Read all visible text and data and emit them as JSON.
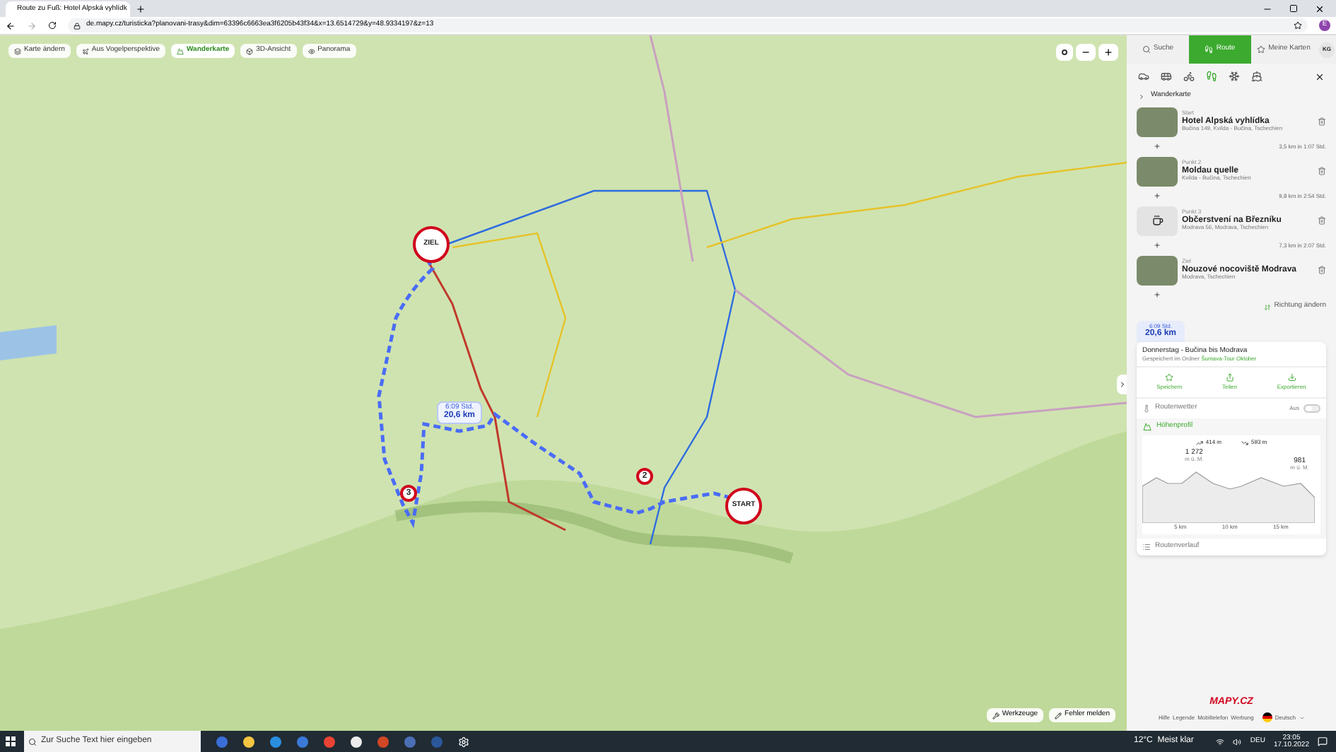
{
  "browser": {
    "tab_title": "Route zu Fuß: Hotel Alpská vyhlídk",
    "url": "de.mapy.cz/turisticka?planovani-trasy&dim=63396c6663ea3f6205b43f34&x=13.6514729&y=48.9334197&z=13",
    "profile": "E"
  },
  "map_toolbar": [
    {
      "label": "Karte ändern",
      "kind": "layers",
      "selected": false
    },
    {
      "label": "Aus Vogelperspektive",
      "kind": "aerial",
      "selected": false
    },
    {
      "label": "Wanderkarte",
      "kind": "hiking",
      "selected": true
    },
    {
      "label": "3D-Ansicht",
      "kind": "cube",
      "selected": false
    },
    {
      "label": "Panorama",
      "kind": "panorama",
      "selected": false
    }
  ],
  "zoom": {
    "out": "−",
    "in": "+"
  },
  "markers": [
    {
      "label": "ZIEL",
      "kind": "end"
    },
    {
      "label": "3",
      "kind": "via"
    },
    {
      "label": "2",
      "kind": "via"
    },
    {
      "label": "START",
      "kind": "start"
    }
  ],
  "route_label": {
    "time": "6:09 Std.",
    "distance": "20,6 km"
  },
  "map_bottom": [
    "Werkzeuge",
    "Fehler melden"
  ],
  "panel": {
    "tabs": [
      {
        "label": "Suche",
        "kind": "search",
        "selected": false
      },
      {
        "label": "Route",
        "kind": "route",
        "selected": true
      },
      {
        "label": "Meine Karten",
        "kind": "star",
        "selected": false
      }
    ],
    "avatar": "KG",
    "modes": [
      {
        "kind": "car",
        "selected": false
      },
      {
        "kind": "bus",
        "selected": false
      },
      {
        "kind": "bike",
        "selected": false
      },
      {
        "kind": "walk",
        "selected": true
      },
      {
        "kind": "ski",
        "selected": false
      },
      {
        "kind": "boat",
        "selected": false
      }
    ],
    "map_type": "Wanderkarte",
    "waypoints": [
      {
        "label": "Start",
        "name": "Hotel Alpská vyhlídka",
        "address": "Bučina 149, Kvilda - Bučina, Tschechien",
        "kind": "photo",
        "segment": "3,5 km in 1:07 Std."
      },
      {
        "label": "Punkt 2",
        "name": "Moldau quelle",
        "address": "Kvilda - Bučina, Tschechien",
        "kind": "photo",
        "segment": "9,8 km in 2:54 Std."
      },
      {
        "label": "Punkt 3",
        "name": "Občerstvení na Březníku",
        "address": "Modrava 56, Modrava, Tschechien",
        "kind": "icon",
        "segment": "7,3 km in 2:07 Std."
      },
      {
        "label": "Ziel",
        "name": "Nouzové nocoviště Modrava",
        "address": "Modrava, Tschechien",
        "kind": "photo"
      }
    ],
    "reverse": "Richtung ändern",
    "summary": {
      "time": "6:09 Std.",
      "distance": "20,6 km"
    },
    "card": {
      "title": "Donnerstag - Bučina bis Modrava",
      "saved_prefix": "Gespeichert im Ordner ",
      "folder": "Šumava-Tour Oktober",
      "actions": [
        {
          "label": "Speichern",
          "kind": "star"
        },
        {
          "label": "Teilen",
          "kind": "share"
        },
        {
          "label": "Exportieren",
          "kind": "export"
        }
      ],
      "weather": {
        "label": "Routenwetter",
        "toggle_label": "Aus",
        "on": false
      },
      "profile": {
        "title": "Höhenprofil",
        "ascent": "414 m",
        "descent": "593 m",
        "max": "1 272",
        "max_unit": "m ü. M.",
        "end": "981",
        "end_unit": "m ü. M.",
        "ticks": [
          "5 km",
          "10 km",
          "15 km"
        ]
      },
      "itinerary": "Routenverlauf"
    },
    "footer": {
      "logo": "MAPY.CZ",
      "links": [
        "Hilfe",
        "Legende",
        "Mobiltelefon",
        "Werbung"
      ],
      "language": "Deutsch"
    }
  },
  "taskbar": {
    "search": "Zur Suche Text hier eingeben",
    "weather": "12°C  Meist klar",
    "lang": "DEU",
    "time": "23:05",
    "date": "17.10.2022"
  }
}
